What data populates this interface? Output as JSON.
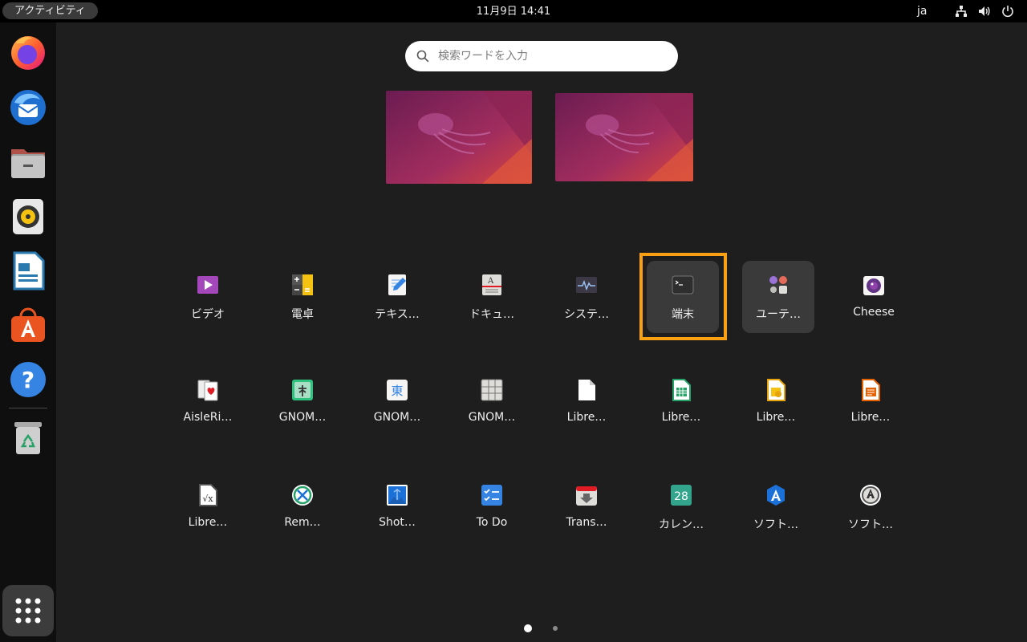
{
  "topbar": {
    "activities_label": "アクティビティ",
    "clock": "11月9日  14:41",
    "language": "ja",
    "tray_icons": [
      "network-icon",
      "volume-icon",
      "power-icon"
    ]
  },
  "dock": {
    "apps": [
      {
        "name": "firefox",
        "icon": "firefox-icon"
      },
      {
        "name": "thunderbird",
        "icon": "thunderbird-icon"
      },
      {
        "name": "files",
        "icon": "files-icon"
      },
      {
        "name": "rhythmbox",
        "icon": "rhythmbox-icon"
      },
      {
        "name": "libreoffice-writer",
        "icon": "writer-icon"
      },
      {
        "name": "software",
        "icon": "software-icon"
      },
      {
        "name": "help",
        "icon": "help-icon"
      },
      {
        "name": "trash",
        "icon": "trash-icon"
      }
    ],
    "show_apps_icon": "app-grid-icon"
  },
  "search": {
    "placeholder": "検索ワードを入力",
    "value": ""
  },
  "workspaces": [
    {
      "name": "workspace-1"
    },
    {
      "name": "workspace-2"
    }
  ],
  "app_grid": {
    "rows": [
      [
        {
          "label": "ビデオ",
          "icon": "videos-icon"
        },
        {
          "label": "電卓",
          "icon": "calculator-icon"
        },
        {
          "label": "テキス…",
          "icon": "text-editor-icon"
        },
        {
          "label": "ドキュ…",
          "icon": "document-viewer-icon"
        },
        {
          "label": "システ…",
          "icon": "system-monitor-icon"
        },
        {
          "label": "端末",
          "icon": "terminal-icon"
        },
        {
          "label": "ユーテ…",
          "icon": "utilities-folder-icon"
        },
        {
          "label": "Cheese",
          "icon": "cheese-icon"
        }
      ],
      [
        {
          "label": "AisleRi…",
          "icon": "aisleriot-icon"
        },
        {
          "label": "GNOM…",
          "icon": "gnome-mahjongg-icon"
        },
        {
          "label": "GNOM…",
          "icon": "gnome-mines-icon"
        },
        {
          "label": "GNOM…",
          "icon": "gnome-sudoku-icon"
        },
        {
          "label": "Libre…",
          "icon": "libreoffice-icon"
        },
        {
          "label": "Libre…",
          "icon": "libreoffice-calc-icon"
        },
        {
          "label": "Libre…",
          "icon": "libreoffice-draw-icon"
        },
        {
          "label": "Libre…",
          "icon": "libreoffice-impress-icon"
        }
      ],
      [
        {
          "label": "Libre…",
          "icon": "libreoffice-math-icon"
        },
        {
          "label": "Rem…",
          "icon": "remmina-icon"
        },
        {
          "label": "Shot…",
          "icon": "shotwell-icon"
        },
        {
          "label": "To Do",
          "icon": "todo-icon"
        },
        {
          "label": "Trans…",
          "icon": "transmission-icon"
        },
        {
          "label": "カレン…",
          "icon": "calendar-icon"
        },
        {
          "label": "ソフト…",
          "icon": "software-center-icon"
        },
        {
          "label": "ソフト…",
          "icon": "software-updater-icon"
        }
      ]
    ],
    "calendar_day": "28",
    "mahjongg_char": "東",
    "focused_app": "端末",
    "hovered_app": "ユーテ…"
  },
  "pager": {
    "pages": 2,
    "current": 1
  },
  "colors": {
    "focus_ring": "#f9a013",
    "background": "#1e1e1e",
    "ubuntu_orange": "#e95420"
  }
}
